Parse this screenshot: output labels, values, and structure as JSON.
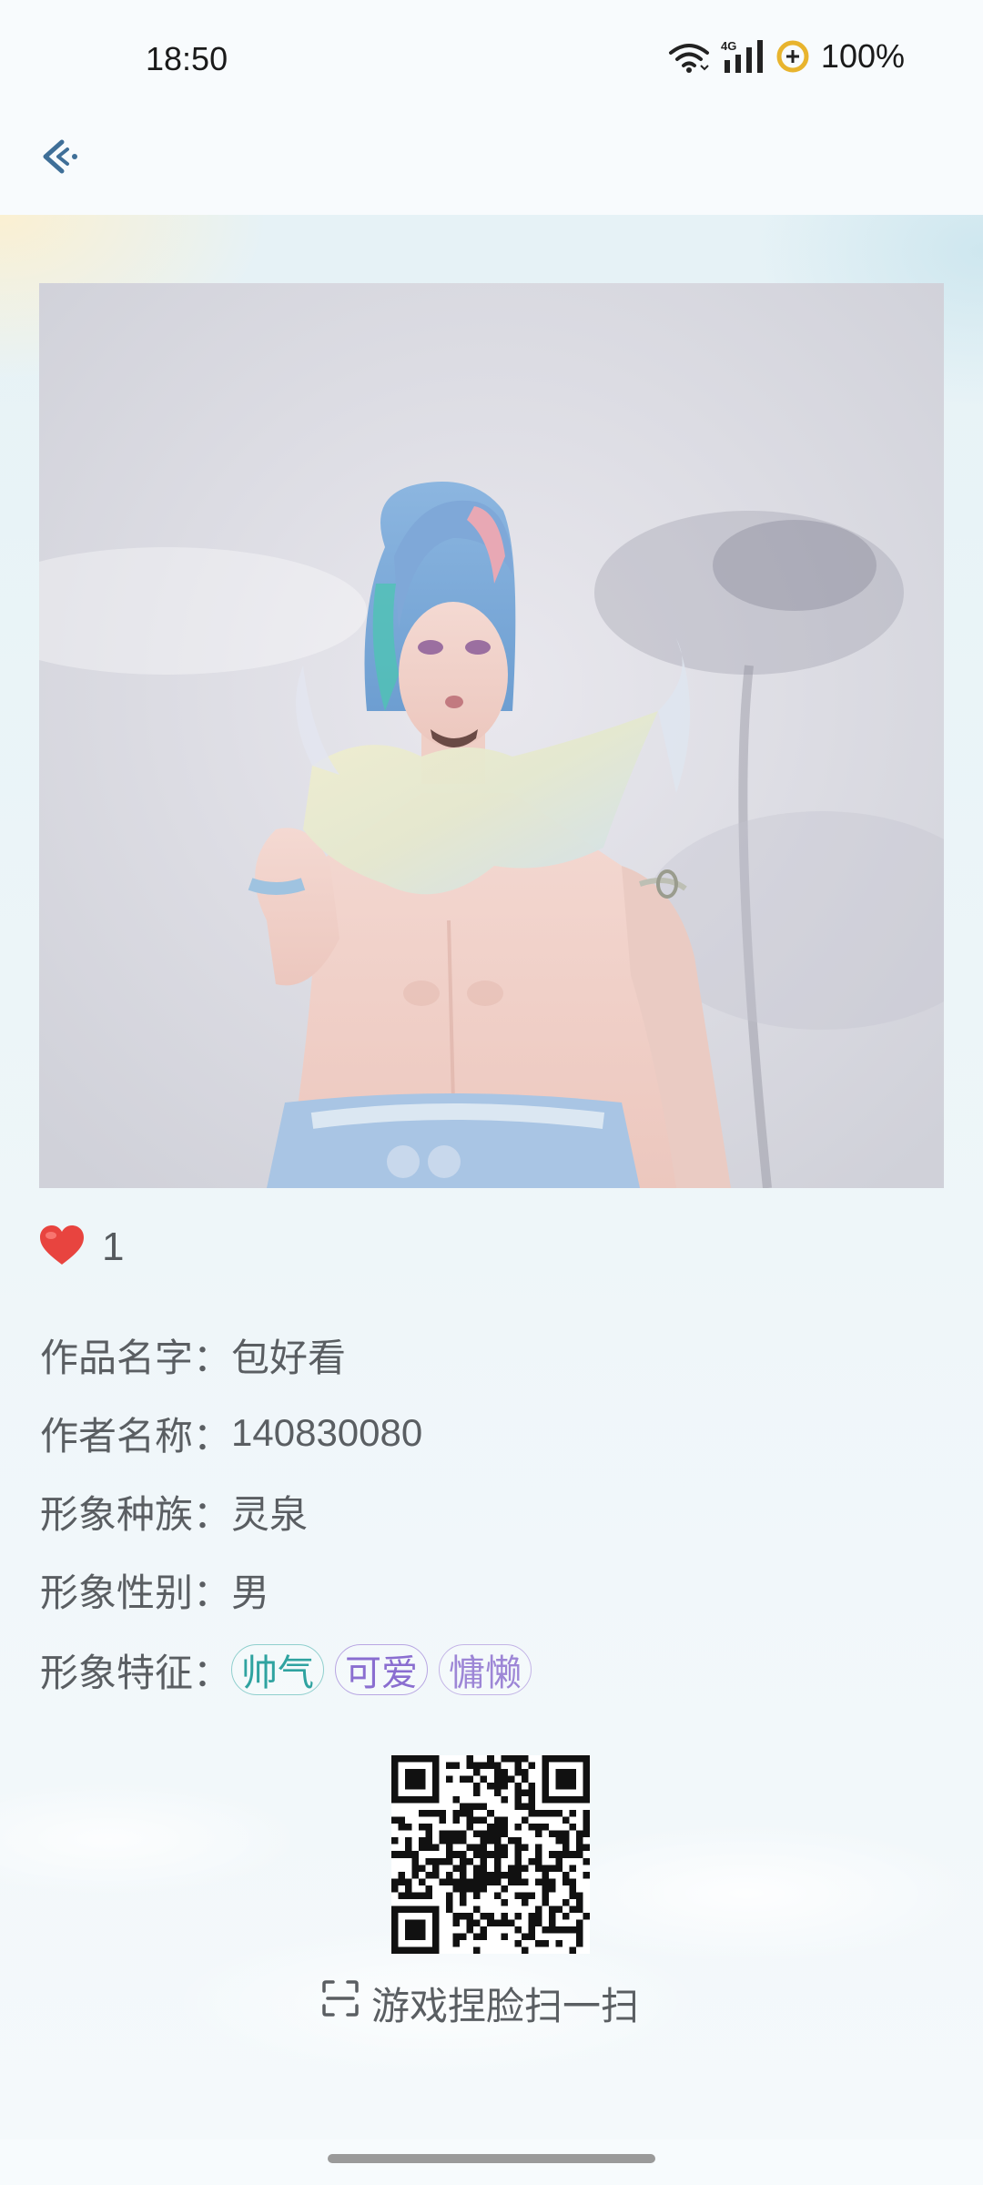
{
  "status_bar": {
    "time": "18:50",
    "network": "4G",
    "battery": "100%",
    "icons": [
      "wifi-icon",
      "signal-icon",
      "battery-saver-icon"
    ]
  },
  "header": {
    "back_icon": "back-arrow-icon"
  },
  "work": {
    "image_description_icon": "character-portrait",
    "likes": "1",
    "like_icon": "heart-icon",
    "name_label": "作品名字：",
    "name_value": "包好看",
    "author_label": "作者名称：",
    "author_value": "140830080",
    "race_label": "形象种族：",
    "race_value": "灵泉",
    "gender_label": "形象性别：",
    "gender_value": "男",
    "traits_label": "形象特征：",
    "traits": [
      "帅气",
      "可爱",
      "慵懒"
    ]
  },
  "scan": {
    "label": "游戏捏脸扫一扫",
    "icon": "scan-icon"
  },
  "colors": {
    "accent": "#3f6f98",
    "tag_teal": "#2fa3a0",
    "tag_purple": "#8a6ed0",
    "heart": "#e8443f"
  }
}
